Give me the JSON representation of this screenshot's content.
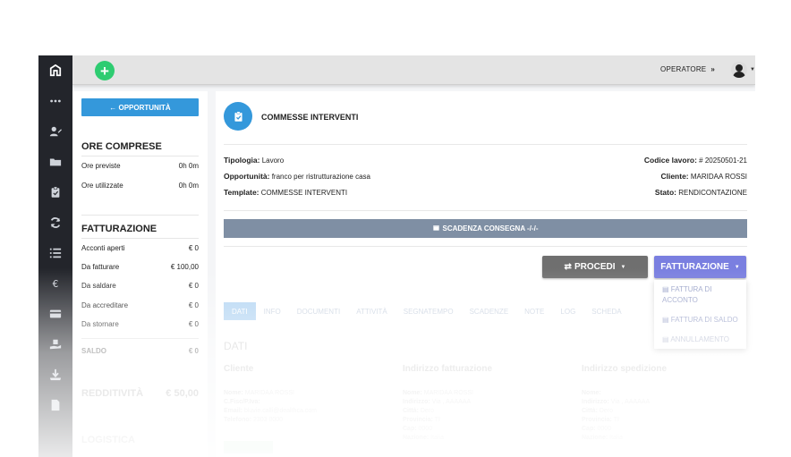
{
  "topbar": {
    "operator_label": "OPERATORE",
    "operator_chevron": "»"
  },
  "side": {
    "back_button": "← OPPORTUNITÀ",
    "hours_title": "ORE COMPRESE",
    "hours": [
      {
        "label": "Ore previste",
        "value": "0h 0m"
      },
      {
        "label": "Ore utilizzate",
        "value": "0h 0m"
      }
    ],
    "billing_title": "FATTURAZIONE",
    "billing": [
      {
        "label": "Acconti aperti",
        "value": "€ 0"
      },
      {
        "label": "Da fatturare",
        "value": "€ 100,00"
      },
      {
        "label": "Da saldare",
        "value": "€ 0"
      },
      {
        "label": "Da accreditare",
        "value": "€ 0"
      },
      {
        "label": "Da stornare",
        "value": "€ 0"
      }
    ],
    "balance": {
      "label": "SALDO",
      "value": "€ 0"
    },
    "profit": {
      "label": "REDDITIVITÀ",
      "value": "€ 50,00"
    },
    "logistics_title": "LOGISTICA"
  },
  "job": {
    "title": "COMMESSE INTERVENTI",
    "type_label": "Tipologia:",
    "type_value": "Lavoro",
    "opportunity_label": "Opportunità:",
    "opportunity_value": "franco per ristrutturazione casa",
    "template_label": "Template:",
    "template_value": "COMMESSE INTERVENTI",
    "code_label": "Codice lavoro:",
    "code_value": "# 20250501-21",
    "client_label": "Cliente:",
    "client_value": "MARIDAA ROSSI",
    "status_label": "Stato:",
    "status_value": "RENDICONTAZIONE"
  },
  "deadline_bar": "SCADENZA CONSEGNA -/-/-",
  "actions": {
    "proceed": "PROCEDI",
    "billing": "FATTURAZIONE",
    "billing_menu": [
      "FATTURA DI ACCONTO",
      "FATTURA DI SALDO",
      "ANNULLAMENTO"
    ]
  },
  "tabs": [
    "DATI",
    "INFO",
    "DOCUMENTI",
    "ATTIVITÀ",
    "SEGNATEMPO",
    "SCADENZE",
    "NOTE",
    "LOG",
    "SCHEDA"
  ],
  "section_title": "DATI",
  "columns": {
    "client": {
      "title": "Cliente",
      "lines": [
        {
          "k": "Nome:",
          "v": "MARIDAA ROSSI"
        },
        {
          "k": "C.Fisc/P.Iva:",
          "v": ""
        },
        {
          "k": "Email:",
          "v": "bluvie.calli@dealthca.com"
        },
        {
          "k": "Telefono:",
          "v": "2303 0000"
        }
      ]
    },
    "billing_address": {
      "title": "Indirizzo fatturazione",
      "lines": [
        {
          "k": "Nome:",
          "v": "MARIDAA ROSSI"
        },
        {
          "k": "Indirizzo:",
          "v": "Via , AAAAAA"
        },
        {
          "k": "Città:",
          "v": "Dero"
        },
        {
          "k": "Provincia:",
          "v": "TI"
        },
        {
          "k": "Cap:",
          "v": "0000"
        },
        {
          "k": "Nazione:",
          "v": "Italia"
        }
      ]
    },
    "shipping_address": {
      "title": "Indirizzo spedizione",
      "lines": [
        {
          "k": "Nome:",
          "v": ""
        },
        {
          "k": "Indirizzo:",
          "v": "Via , AAAAAA"
        },
        {
          "k": "Città:",
          "v": "Dero"
        },
        {
          "k": "Provincia:",
          "v": "TI"
        },
        {
          "k": "Cap:",
          "v": "0000"
        },
        {
          "k": "Nazione:",
          "v": "Italia"
        }
      ]
    }
  },
  "colors": {
    "primary": "#3498db",
    "success": "#2ecc71",
    "billing_btn": "#7a7fe0",
    "proceed_btn": "#6f6f6f",
    "rail": "#23252b"
  }
}
